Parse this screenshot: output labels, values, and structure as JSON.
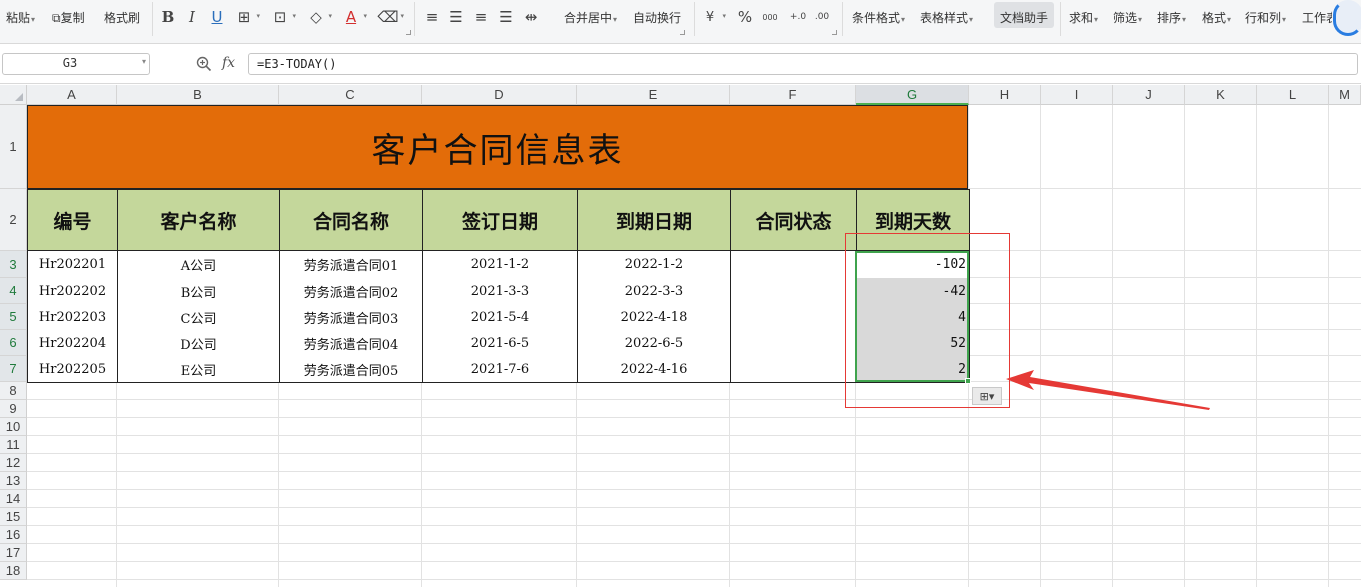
{
  "ribbon": {
    "paste": "粘贴",
    "copy": "复制",
    "format_painter": "格式刷",
    "merge_center": "合并居中",
    "wrap_text": "自动换行",
    "currency_symbol": "¥",
    "percent_symbol": "%",
    "thousands_symbol": "000",
    "dec_increase": "+.0",
    "dec_decrease": ".00",
    "conditional_format": "条件格式",
    "table_style": "表格样式",
    "doc_assistant": "文档助手",
    "sum": "求和",
    "filter": "筛选",
    "sort": "排序",
    "format": "格式",
    "row_col": "行和列",
    "worksheet": "工作表",
    "bold": "B",
    "italic": "I",
    "underline": "U",
    "font_color": "A"
  },
  "formula_bar": {
    "name_box": "G3",
    "fx": "fx",
    "formula": "=E3-TODAY()"
  },
  "columns": [
    "A",
    "B",
    "C",
    "D",
    "E",
    "F",
    "G",
    "H",
    "I",
    "J",
    "K",
    "L",
    "M"
  ],
  "rows": [
    "1",
    "2",
    "3",
    "4",
    "5",
    "6",
    "7",
    "8",
    "9",
    "10",
    "11",
    "12",
    "13",
    "14",
    "15",
    "16",
    "17",
    "18"
  ],
  "sheet": {
    "title": "客户合同信息表",
    "headers": [
      "编号",
      "客户名称",
      "合同名称",
      "签订日期",
      "到期日期",
      "合同状态",
      "到期天数"
    ],
    "records": [
      [
        "Hr202201",
        "A公司",
        "劳务派遣合同01",
        "2021-1-2",
        "2022-1-2",
        "",
        "-102"
      ],
      [
        "Hr202202",
        "B公司",
        "劳务派遣合同02",
        "2021-3-3",
        "2022-3-3",
        "",
        "-42"
      ],
      [
        "Hr202203",
        "C公司",
        "劳务派遣合同03",
        "2021-5-4",
        "2022-4-18",
        "",
        "4"
      ],
      [
        "Hr202204",
        "D公司",
        "劳务派遣合同04",
        "2021-6-5",
        "2022-6-5",
        "",
        "52"
      ],
      [
        "Hr202205",
        "E公司",
        "劳务派遣合同05",
        "2021-7-6",
        "2022-4-16",
        "",
        "2"
      ]
    ]
  },
  "colors": {
    "title_fill": "#e36c09",
    "header_fill": "#c4d79b",
    "selection": "#3fa34d",
    "annotation": "#e53935"
  }
}
